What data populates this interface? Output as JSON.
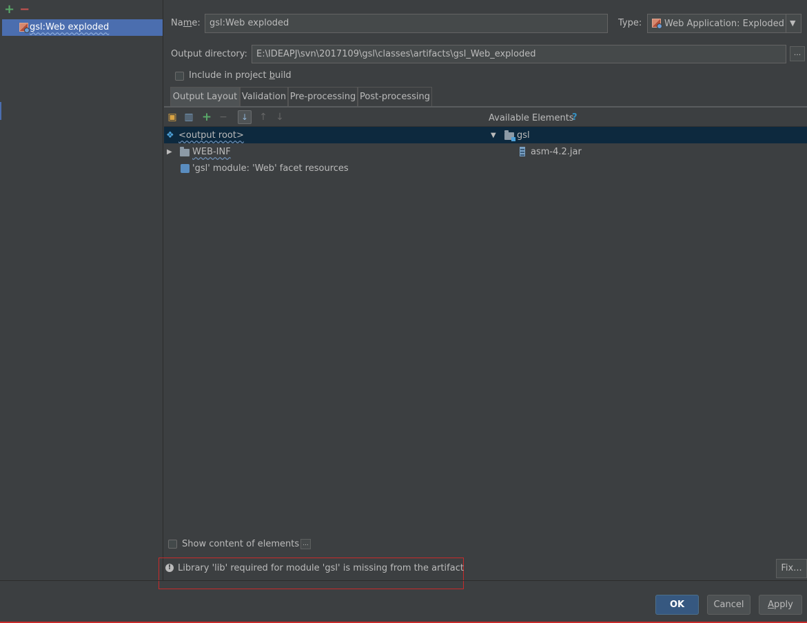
{
  "sidebar": {
    "items": [
      {
        "label": "gsl:Web exploded",
        "icon": "war-exploded-icon"
      }
    ]
  },
  "form": {
    "name_label_pre": "Na",
    "name_label_mn": "m",
    "name_label_post": "e:",
    "name_value": "gsl:Web exploded",
    "type_label": "Type:",
    "type_value": "Web Application: Exploded",
    "output_dir_label": "Output directory:",
    "output_dir_value": "E:\\IDEAPJ\\svn\\2017109\\gsl\\classes\\artifacts\\gsl_Web_exploded",
    "browse_label": "...",
    "include_build_pre": "Include in project ",
    "include_build_mn": "b",
    "include_build_post": "uild"
  },
  "tabs": [
    {
      "label": "Output Layout",
      "active": true
    },
    {
      "label": "Validation",
      "active": false
    },
    {
      "label": "Pre-processing",
      "active": false
    },
    {
      "label": "Post-processing",
      "active": false
    }
  ],
  "layout_tree": {
    "items": [
      {
        "label": "<output root>",
        "icon": "output-root-icon"
      },
      {
        "label": "WEB-INF",
        "icon": "folder-icon"
      },
      {
        "label": "'gsl' module: 'Web' facet resources",
        "icon": "web-facet-icon"
      }
    ]
  },
  "available": {
    "title": "Available Elements",
    "help": "?",
    "items": [
      {
        "label": "gsl",
        "icon": "module-folder-icon"
      },
      {
        "label": "asm-4.2.jar",
        "icon": "jar-icon"
      }
    ]
  },
  "show_content": {
    "label": "Show content of elements",
    "button": "..."
  },
  "warning": {
    "text": "Library 'lib' required for module 'gsl' is missing from the artifact",
    "fix_label": "Fix..."
  },
  "buttons": {
    "ok": "OK",
    "cancel": "Cancel",
    "apply_mn": "A",
    "apply_rest": "pply"
  },
  "colors": {
    "background": "#3c3f41",
    "selection": "#4b6eaf",
    "tree_selection": "#0d293e",
    "warning_border": "#c82b2b",
    "ok_button": "#365880"
  }
}
